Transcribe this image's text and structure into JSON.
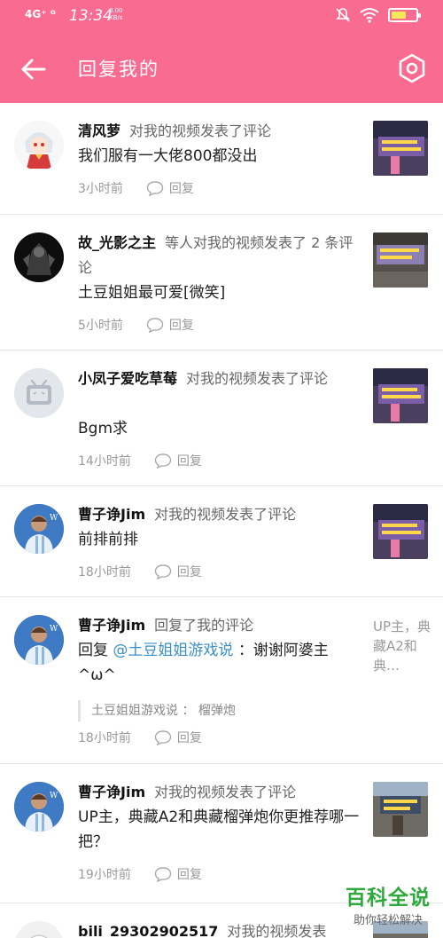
{
  "status_bar": {
    "signal": "4G⁺ ᴳ",
    "time": "13:34",
    "net_speed": "0.00 KB/s",
    "battery_fill": 0.6
  },
  "app_bar": {
    "title": "回复我的"
  },
  "items": [
    {
      "username": "清风萝",
      "action": "对我的视频发表了评论",
      "content": "我们服有一大佬800都没出",
      "time": "3小时前",
      "reply_label": "回复"
    },
    {
      "username": "故_光影之主",
      "action": "等人对我的视频发表了 2 条评论",
      "content": "土豆姐姐最可爱[微笑]",
      "time": "5小时前",
      "reply_label": "回复"
    },
    {
      "username": "小凤子爱吃草莓",
      "action": "对我的视频发表了评论",
      "content": "Bgm求",
      "time": "14小时前",
      "reply_label": "回复"
    },
    {
      "username": "曹子诤Jim",
      "action": "对我的视频发表了评论",
      "content": "前排前排",
      "time": "18小时前",
      "reply_label": "回复"
    },
    {
      "username": "曹子诤Jim",
      "action": "回复了我的评论",
      "content_prefix": "回复",
      "mention": "@土豆姐姐游戏说",
      "content_suffix": "：谢谢阿婆主^ω^",
      "quote_author": "土豆姐姐游戏说",
      "quote_text": "榴弹炮",
      "side_text": "UP主，典藏A2和典…",
      "time": "18小时前",
      "reply_label": "回复"
    },
    {
      "username": "曹子诤Jim",
      "action": "对我的视频发表了评论",
      "content": "UP主，典藏A2和典藏榴弹炮你更推荐哪一把？",
      "time": "19小时前",
      "reply_label": "回复"
    },
    {
      "username": "bili_29302902517",
      "action": "对我的视频发表"
    }
  ],
  "watermark": {
    "title": "百科全说",
    "subtitle": "助你轻松解决"
  },
  "colors": {
    "brand_pink": "#f96b91",
    "mention_blue": "#3a8fc6"
  }
}
